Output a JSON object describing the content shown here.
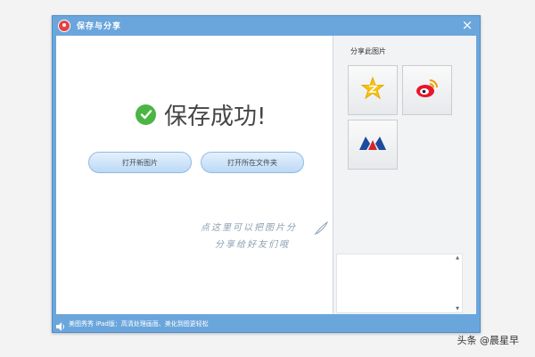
{
  "window": {
    "title": "保存与分享",
    "close_label": "×"
  },
  "main": {
    "success_message": "保存成功!",
    "open_image_button": "打开新图片",
    "open_folder_button": "打开所在文件夹",
    "handwriting_line1": "点这里可以把图片分",
    "handwriting_line2": "分享给好友们哦"
  },
  "sidebar": {
    "title": "分享此图片",
    "share_targets": [
      {
        "icon": "qzone-star-icon"
      },
      {
        "icon": "weibo-icon"
      },
      {
        "icon": "renren-icon"
      }
    ]
  },
  "status": {
    "text": "美图秀秀 iPad版：高清处理画面、美化到图更轻松"
  },
  "watermark": {
    "text": "头条 @晨星早"
  },
  "colors": {
    "window_blue": "#6aa6dc",
    "success_green": "#4bb543",
    "button_blue": "#bcd9f5"
  }
}
